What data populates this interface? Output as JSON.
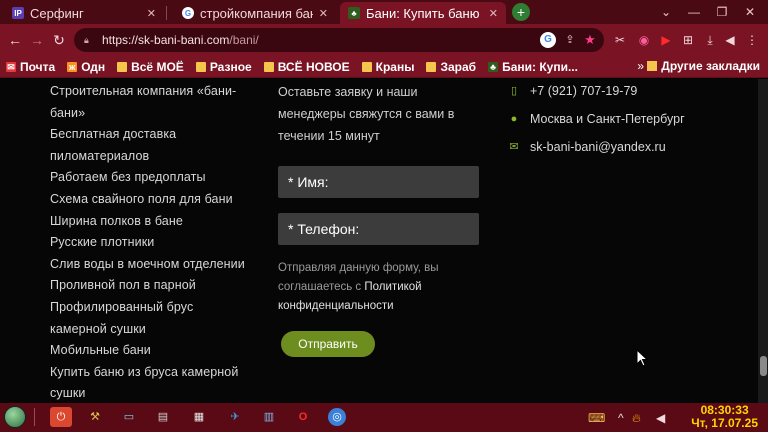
{
  "browser": {
    "tabs": [
      {
        "title": "Серфинг",
        "favicon": "ip-favicon",
        "active": false
      },
      {
        "title": "стройкомпания бан",
        "favicon": "google-favicon",
        "active": false
      },
      {
        "title": "Бани: Купить баню",
        "favicon": "leaf-favicon",
        "active": true
      }
    ],
    "new_tab": "+",
    "url_host": "https://sk-bani-bani.com",
    "url_path": "/bani/",
    "bookmarks": [
      {
        "label": "Почта",
        "icon": "mail-icon"
      },
      {
        "label": "Одн",
        "icon": "ok-icon"
      },
      {
        "label": "Всё МОЁ",
        "icon": "folder-icon"
      },
      {
        "label": "Разное",
        "icon": "folder-icon"
      },
      {
        "label": "ВСЁ НОВОЕ",
        "icon": "folder-icon"
      },
      {
        "label": "Краны",
        "icon": "folder-icon"
      },
      {
        "label": "Зараб",
        "icon": "folder-icon"
      },
      {
        "label": "Бани: Купи...",
        "icon": "leaf-icon"
      }
    ],
    "bookmarks_more": "»",
    "other_bookmarks": "Другие закладки"
  },
  "page": {
    "menu_links": [
      "Строительная компания «бани-",
      "бани»",
      "Бесплатная доставка",
      "пиломатериалов",
      "Работаем без предоплаты",
      "Схема свайного поля для бани",
      "Ширина полков в бане",
      "Русские плотники",
      "Слив воды в моечном отделении",
      "Проливной пол в парной",
      "Профилированный брус",
      "камерной сушки",
      "Мобильные бани",
      "Купить баню из бруса камерной",
      "сушки"
    ],
    "form": {
      "intro": "Оставьте заявку и наши менеджеры свяжутся с вами в течении 15 минут",
      "name_placeholder": "* Имя:",
      "phone_placeholder": "* Телефон:",
      "consent_text": "Отправляя данную форму, вы соглашаетесь с",
      "consent_link": "Политикой конфиденциальности",
      "submit": "Отправить"
    },
    "contacts": {
      "phone": "+7 (921) 707-19-79",
      "location": "Москва и Санкт-Петербург",
      "email": "sk-bani-bani@yandex.ru"
    }
  },
  "taskbar": {
    "time": "08:30:33",
    "date": "Чт, 17.07.25"
  },
  "colors": {
    "accent": "#7a1424",
    "button": "#6d8e1e",
    "icon_green": "#8db82c",
    "clock": "#ffd400"
  }
}
